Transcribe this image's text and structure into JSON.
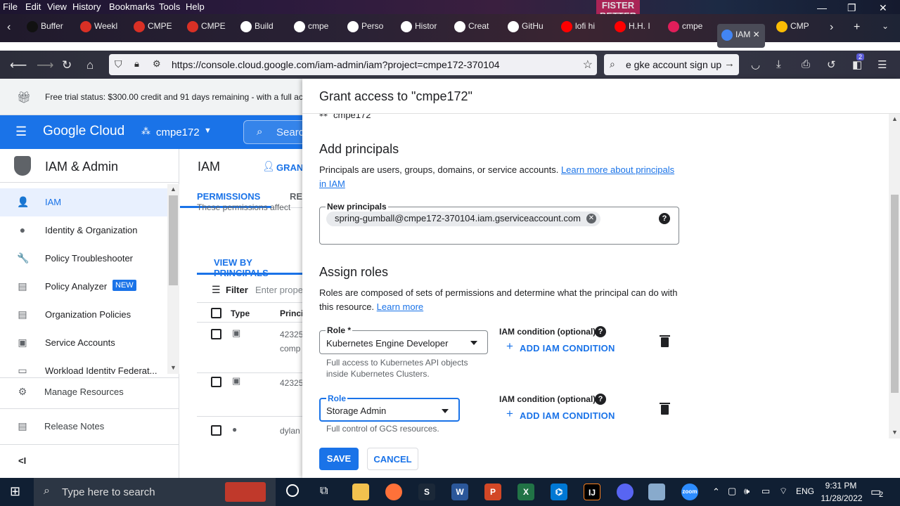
{
  "browser": {
    "menu": [
      "File",
      "Edit",
      "View",
      "History",
      "Bookmarks",
      "Tools",
      "Help"
    ],
    "wallpaper_sign": "FISTER BETTER",
    "tabs": [
      {
        "label": "Buffer",
        "color": "#111111"
      },
      {
        "label": "Weekl",
        "color": "#d93025"
      },
      {
        "label": "CMPE",
        "color": "#d93025"
      },
      {
        "label": "CMPE",
        "color": "#d93025"
      },
      {
        "label": "Build",
        "color": "#ffffff"
      },
      {
        "label": "cmpe",
        "color": "#ffffff"
      },
      {
        "label": "Perso",
        "color": "#ffffff"
      },
      {
        "label": "Histor",
        "color": "#ffffff"
      },
      {
        "label": "Creat",
        "color": "#ffffff"
      },
      {
        "label": "GitHu",
        "color": "#ffffff"
      },
      {
        "label": "lofi hi",
        "color": "#ff0000"
      },
      {
        "label": "H.H. I",
        "color": "#ff0000"
      },
      {
        "label": "cmpe",
        "color": "#e01e5a"
      },
      {
        "label": "IAM",
        "color": "#4285f4"
      },
      {
        "label": "CMP",
        "color": "#fbbc04"
      }
    ],
    "url": "https://console.cloud.google.com/iam-admin/iam?project=cmpe172-370104",
    "search": "e gke account sign up",
    "badge": "2"
  },
  "gcp": {
    "trial": "Free trial status: $300.00 credit and 91 days remaining - with a full ac",
    "brand": "Google Cloud",
    "project": "cmpe172",
    "search_label": "Searc",
    "section_title": "IAM & Admin",
    "nav": [
      {
        "label": "IAM",
        "icon": "person-add-icon",
        "glyph": "👤"
      },
      {
        "label": "Identity & Organization",
        "icon": "account-circle-icon",
        "glyph": "●"
      },
      {
        "label": "Policy Troubleshooter",
        "icon": "wrench-icon",
        "glyph": "🔧"
      },
      {
        "label": "Policy Analyzer",
        "icon": "document-search-icon",
        "glyph": "▤"
      },
      {
        "label": "Organization Policies",
        "icon": "list-icon",
        "glyph": "▤"
      },
      {
        "label": "Service Accounts",
        "icon": "service-account-icon",
        "glyph": "▣"
      },
      {
        "label": "Workload Identity Federat...",
        "icon": "id-card-icon",
        "glyph": "▭"
      }
    ],
    "nav_new": "NEW",
    "manage_resources": "Manage Resources",
    "release_notes": "Release Notes",
    "collapse": "<I",
    "main_title": "IAM",
    "grant": "GRANT",
    "tabs": [
      "PERMISSIONS",
      "REC"
    ],
    "partial_text": "These permissions affect",
    "view_by": "VIEW BY PRINCIPALS",
    "filter": "Filter",
    "filter_placeholder": "Enter prope",
    "col_type": "Type",
    "col_principal": "Princi",
    "rows": [
      {
        "principal": "42325",
        "sub": "comp"
      },
      {
        "principal": "42325",
        "sub": ""
      },
      {
        "principal": "dylan",
        "sub": ""
      }
    ]
  },
  "panel": {
    "title": "Grant access to \"cmpe172\"",
    "resource": "cmpe172",
    "add_principals": "Add principals",
    "principals_desc": "Principals are users, groups, domains, or service accounts.",
    "principals_link": "Learn more about principals in IAM",
    "new_principals_label": "New principals",
    "principal_chip": "spring-gumball@cmpe172-370104.iam.gserviceaccount.com",
    "assign_roles": "Assign roles",
    "roles_desc": "Roles are composed of sets of permissions and determine what the principal can do with this resource.",
    "roles_link": "Learn more",
    "role1_label": "Role *",
    "role1_value": "Kubernetes Engine Developer",
    "role1_hint": "Full access to Kubernetes API objects inside Kubernetes Clusters.",
    "role2_label": "Role",
    "role2_value": "Storage Admin",
    "role2_hint": "Full control of GCS resources.",
    "condition_label": "IAM condition (optional)",
    "add_condition": "ADD IAM CONDITION",
    "save": "SAVE",
    "cancel": "CANCEL"
  },
  "taskbar": {
    "search_placeholder": "Type here to search",
    "lang": "ENG",
    "time": "9:31 PM",
    "date": "11/28/2022",
    "notif": "2"
  },
  "colors": {
    "accent": "#1a73e8",
    "gcp_bar": "#1a73e8"
  }
}
